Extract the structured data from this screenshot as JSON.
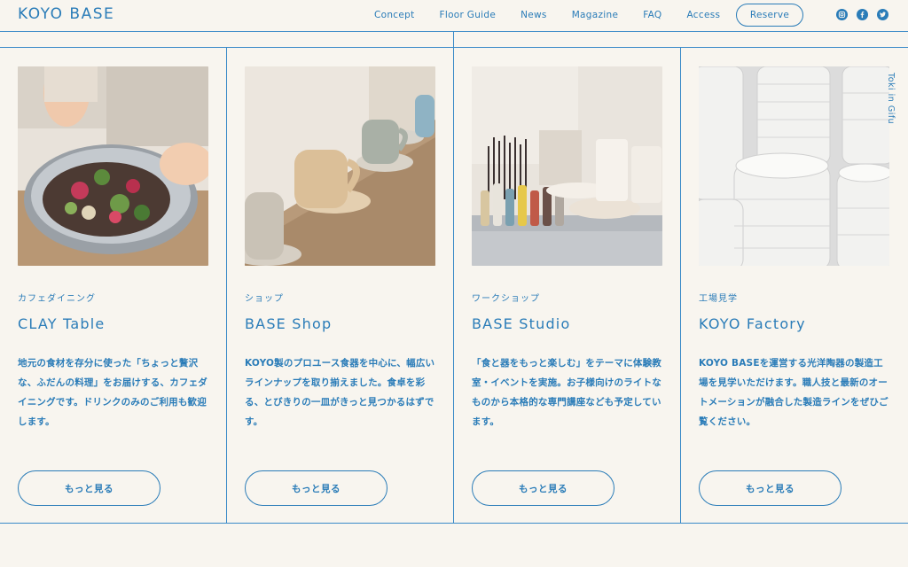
{
  "brand": {
    "logo": "KOYO BASE"
  },
  "nav": {
    "items": [
      "Concept",
      "Floor Guide",
      "News",
      "Magazine",
      "FAQ",
      "Access"
    ],
    "reserve": "Reserve",
    "social": [
      "instagram-icon",
      "facebook-icon",
      "twitter-icon"
    ]
  },
  "side_text": "Toki in Gifu",
  "cards": [
    {
      "category": "カフェダイニング",
      "title": "CLAY Table",
      "description": "地元の食材を存分に使った「ちょっと贅沢な、ふだんの料理」をお届けする、カフェダイニングです。ドリンクのみのご利用も歓迎します。",
      "button": "もっと見る"
    },
    {
      "category": "ショップ",
      "title": "BASE Shop",
      "description": "KOYO製のプロユース食器を中心に、幅広いラインナップを取り揃えました。食卓を彩る、とびきりの一皿がきっと見つかるはずです。",
      "button": "もっと見る"
    },
    {
      "category": "ワークショップ",
      "title": "BASE Studio",
      "description": "「食と器をもっと楽しむ」をテーマに体験教室・イベントを実施。お子様向けのライトなものから本格的な専門講座なども予定しています。",
      "button": "もっと見る"
    },
    {
      "category": "工場見学",
      "title": "KOYO Factory",
      "description": "KOYO BASEを運営する光洋陶器の製造工場を見学いただけます。職人技と最新のオートメーションが融合した製造ラインをぜひご覧ください。",
      "button": "もっと見る"
    }
  ],
  "colors": {
    "accent": "#2a7cb8",
    "background": "#f8f5ef"
  }
}
